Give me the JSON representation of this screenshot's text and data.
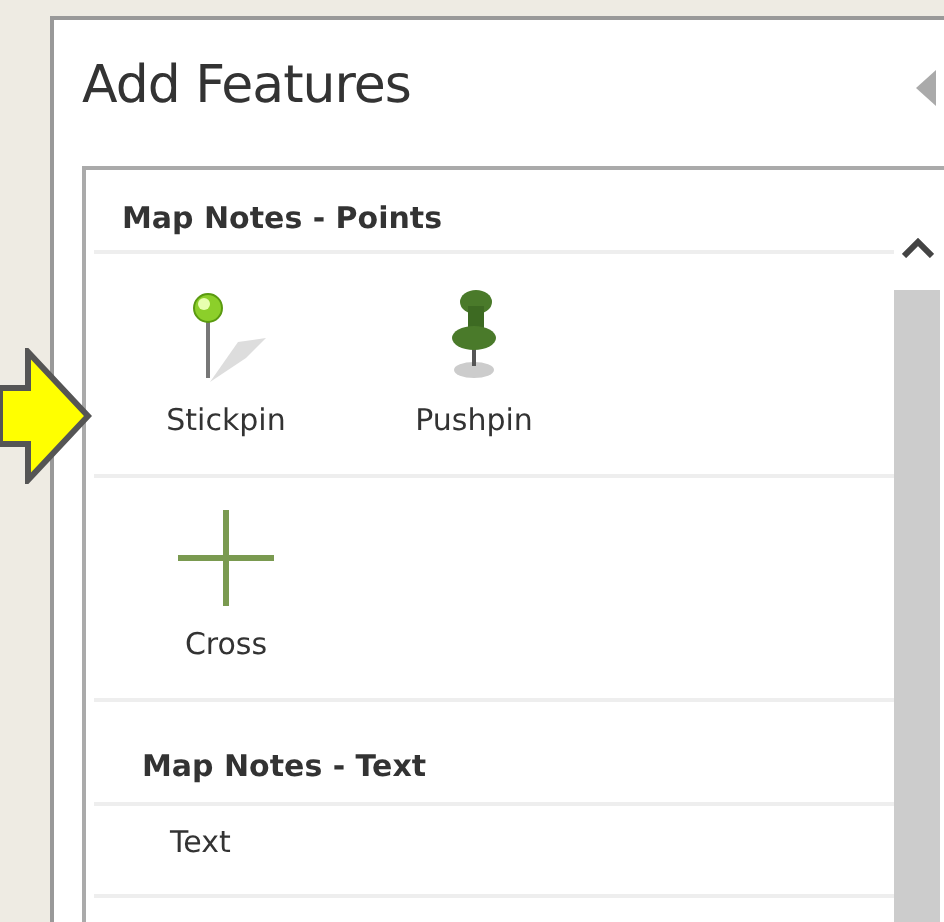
{
  "panel": {
    "title": "Add Features"
  },
  "sections": [
    {
      "title": "Map Notes - Points",
      "kind": "icon_grid",
      "items": [
        {
          "label": "Stickpin",
          "kind": "stickpin"
        },
        {
          "label": "Pushpin",
          "kind": "pushpin"
        },
        {
          "label": "Cross",
          "kind": "cross"
        }
      ]
    },
    {
      "title": "Map Notes - Text",
      "kind": "list",
      "items": [
        {
          "label": "Text",
          "kind": "text"
        }
      ]
    }
  ]
}
